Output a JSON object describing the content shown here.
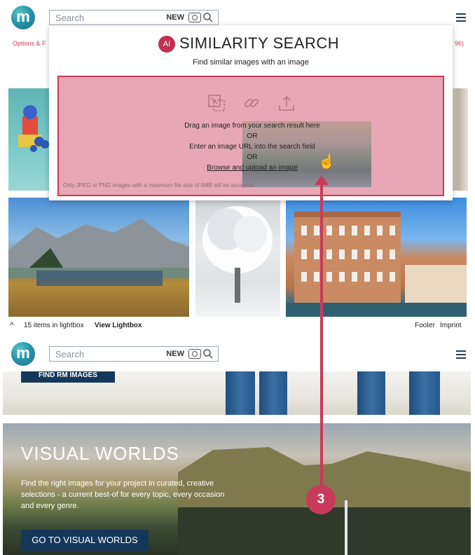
{
  "header": {
    "logo_letter": "m",
    "search_placeholder": "Search",
    "new_label": "NEW",
    "camera_icon": "camera-icon",
    "search_icon": "magnifier-icon",
    "menu_icon": "hamburger-menu-icon"
  },
  "subline": {
    "left_text": "Options & F",
    "right_text": "96)"
  },
  "similarity_overlay": {
    "badge_text": "Aí",
    "title": "SIMILARITY SEARCH",
    "subtitle": "Find similar images with an image",
    "dropzone_icons": [
      "drag-drop-icon",
      "link-icon",
      "upload-icon"
    ],
    "line1": "Drag an image from your search result here",
    "or1": "OR",
    "line2": "Enter an image URL into the search field",
    "or2": "OR",
    "line3": "Browse and upload an image",
    "note": "Only JPEG or PNG images with a maximum file size of 6MB will be accepted"
  },
  "lightbox_bar": {
    "caret": "^",
    "count_text": "15 items in lightbox",
    "view_label": "View Lightbox",
    "footer_label": "Footer",
    "imprint_label": "Imprint"
  },
  "bottom": {
    "find_button": "FIND RM IMAGES",
    "hero_title": "VISUAL WORLDS",
    "hero_text": "Find the right images for your project in curated, creative selections - a current best-of for every topic, every occasion and every genre.",
    "hero_button": "GO TO VISUAL WORLDS"
  },
  "annotation": {
    "step_number": "3",
    "color": "#c93a5a"
  }
}
